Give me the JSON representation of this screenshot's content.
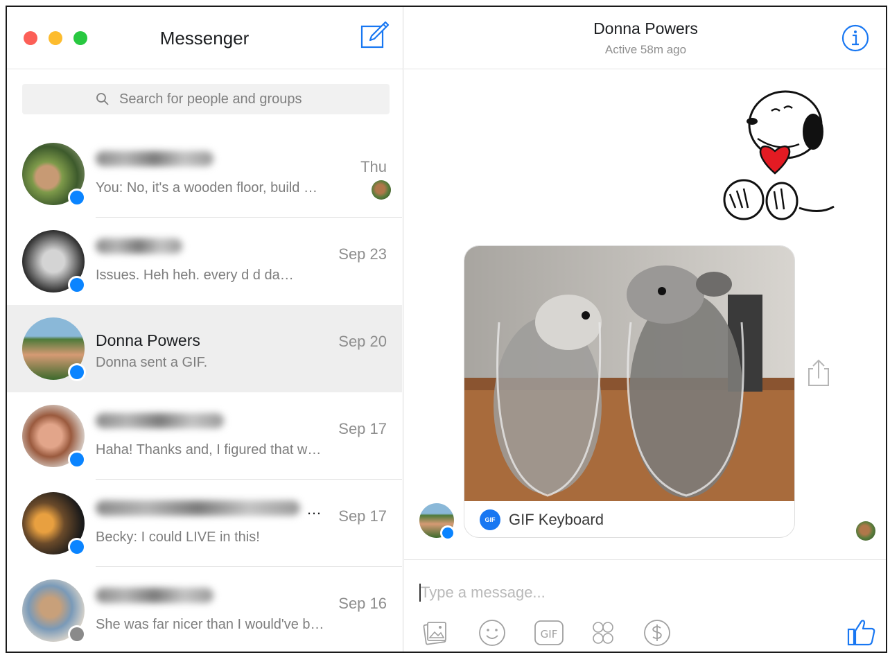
{
  "app": {
    "title": "Messenger"
  },
  "search": {
    "placeholder": "Search for people and groups"
  },
  "conversations": [
    {
      "name": "",
      "blurred_name": true,
      "date": "Thu",
      "preview": "You: No, it's a wooden floor, build …",
      "badge": "messenger"
    },
    {
      "name": "",
      "blurred_name": true,
      "date": "Sep 23",
      "preview": "Issues. Heh heh. every d      d da…",
      "badge": "messenger"
    },
    {
      "name": "Donna Powers",
      "blurred_name": false,
      "date": "Sep 20",
      "preview": "Donna sent a GIF.",
      "badge": "messenger",
      "active": true
    },
    {
      "name": "",
      "blurred_name": true,
      "date": "Sep 17",
      "preview": "Haha! Thanks and, I figured that w…",
      "badge": "messenger"
    },
    {
      "name": "",
      "blurred_name": true,
      "name_suffix": "…",
      "date": "Sep 17",
      "preview": "Becky: I could LIVE in this!",
      "badge": "messenger"
    },
    {
      "name": "",
      "blurred_name": true,
      "date": "Sep 16",
      "preview": "She was far nicer than I would've b…",
      "badge": "facebook"
    }
  ],
  "chat": {
    "contact_name": "Donna Powers",
    "status": "Active 58m ago",
    "attachment": {
      "source_logo": "GIF",
      "source_label": "GIF Keyboard"
    }
  },
  "composer": {
    "placeholder": "Type a message...",
    "tools": [
      "photo-icon",
      "emoji-icon",
      "gif-icon",
      "sticker-icon",
      "payment-icon"
    ],
    "gif_label": "GIF"
  },
  "colors": {
    "accent": "#1877f2",
    "messenger_badge": "#0a84ff",
    "active_row": "#eeeeee",
    "traffic_red": "#fc5f57",
    "traffic_yellow": "#fdbc2e",
    "traffic_green": "#28c840"
  }
}
